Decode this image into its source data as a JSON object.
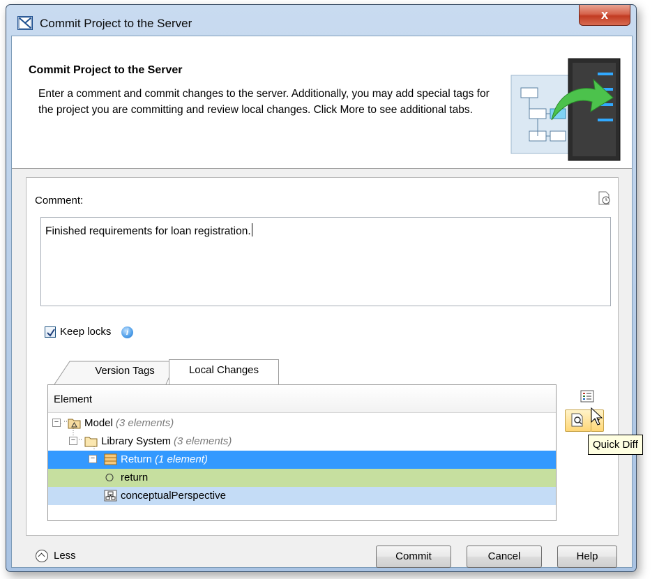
{
  "window": {
    "title": "Commit Project to the Server",
    "close_label": "x"
  },
  "header": {
    "title": "Commit Project to the Server",
    "description": "Enter a comment and commit changes to the server. Additionally, you may add special tags for the project you are committing and review local changes. Click More to see additional tabs."
  },
  "comment": {
    "label": "Comment:",
    "value": "Finished requirements for loan registration."
  },
  "keep_locks": {
    "label": "Keep locks",
    "checked": true
  },
  "tabs": [
    {
      "label": "Version Tags",
      "active": false
    },
    {
      "label": "Local Changes",
      "active": true
    }
  ],
  "tree": {
    "column_header": "Element",
    "rows": [
      {
        "name": "Model",
        "count": "(3 elements)",
        "icon": "model-icon"
      },
      {
        "name": "Library System",
        "count": "(3 elements)",
        "icon": "folder-icon"
      },
      {
        "name": "Return",
        "count": "(1 element)",
        "icon": "class-icon"
      },
      {
        "name": "return",
        "count": "",
        "icon": "operation-icon"
      },
      {
        "name": "conceptualPerspective",
        "count": "",
        "icon": "diagram-icon"
      }
    ]
  },
  "tooltip": "Quick Diff",
  "footer": {
    "less_label": "Less",
    "commit_label": "Commit",
    "cancel_label": "Cancel",
    "help_label": "Help"
  },
  "colors": {
    "selection": "#3399ff",
    "added_row": "#c6df9f",
    "modified_row": "#c4dcf6"
  }
}
